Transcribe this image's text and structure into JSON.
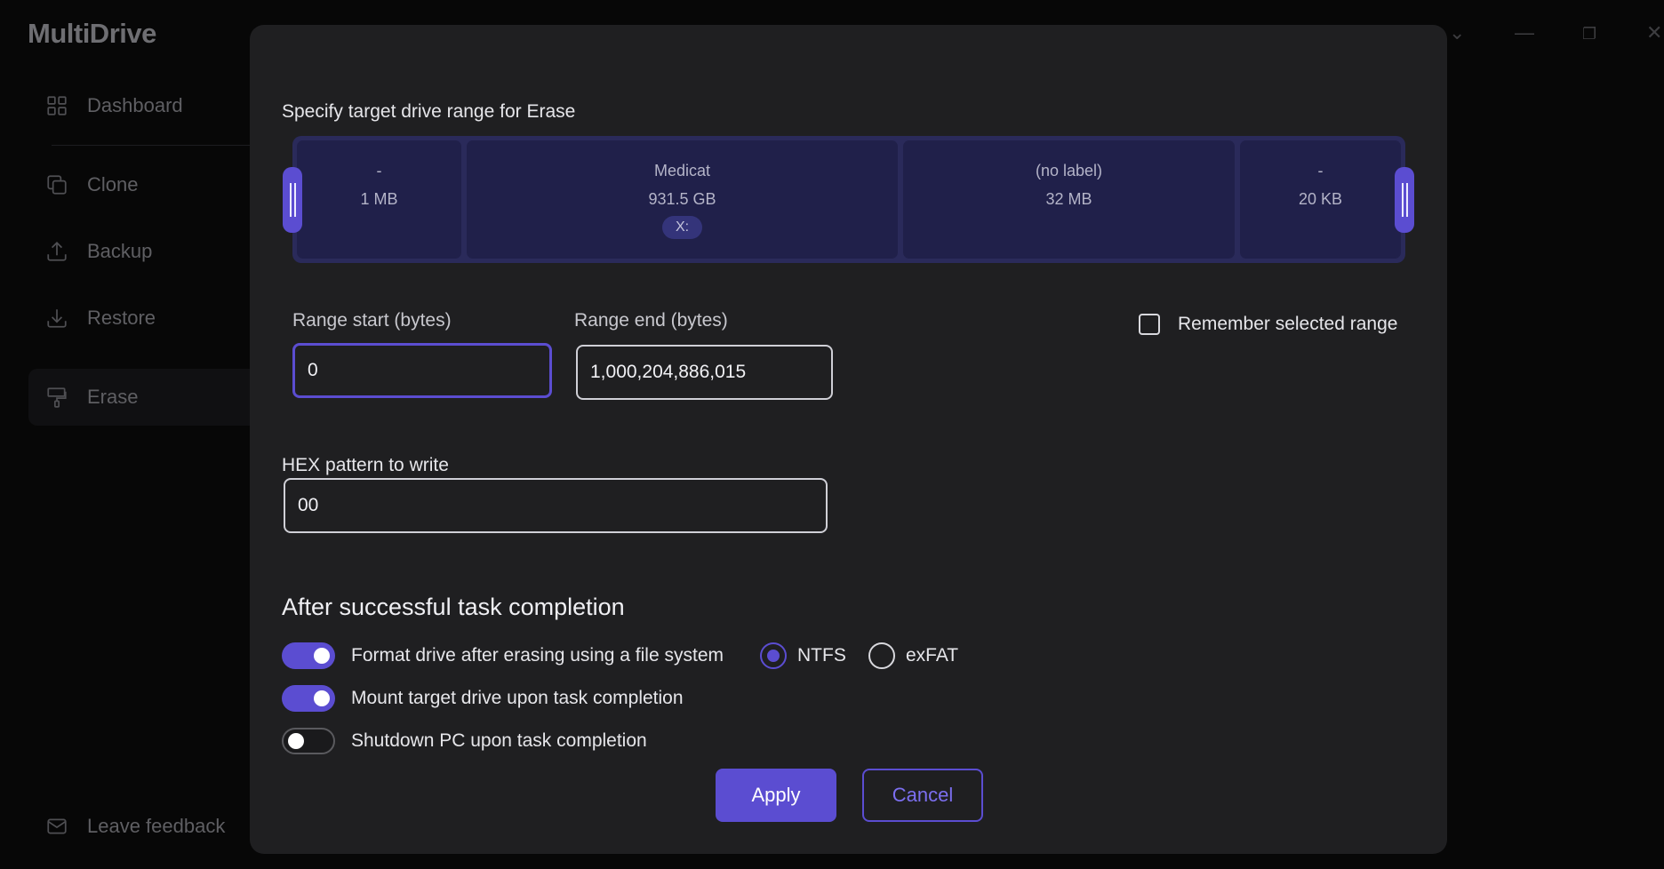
{
  "app": {
    "title": "MultiDrive"
  },
  "sidebar": {
    "items": [
      {
        "label": "Dashboard",
        "icon": "grid-icon"
      },
      {
        "label": "Clone",
        "icon": "copy-icon"
      },
      {
        "label": "Backup",
        "icon": "upload-icon"
      },
      {
        "label": "Restore",
        "icon": "download-icon"
      },
      {
        "label": "Erase",
        "icon": "brush-icon"
      }
    ],
    "active": "Erase",
    "feedback_label": "Leave feedback"
  },
  "modal": {
    "range_title": "Specify target drive range for Erase",
    "partitions": [
      {
        "name": "-",
        "size": "1 MB",
        "letter": ""
      },
      {
        "name": "Medicat",
        "size": "931.5 GB",
        "letter": "X:"
      },
      {
        "name": "(no label)",
        "size": "32 MB",
        "letter": ""
      },
      {
        "name": "-",
        "size": "20 KB",
        "letter": ""
      }
    ],
    "range_start_label": "Range start (bytes)",
    "range_start_value": "0",
    "range_end_label": "Range end (bytes)",
    "range_end_value": "1,000,204,886,015",
    "remember_label": "Remember selected range",
    "remember_checked": false,
    "hex_label": "HEX pattern to write",
    "hex_value": "00",
    "completion_heading": "After successful task completion",
    "options": [
      {
        "label": "Format drive after erasing using a file system",
        "enabled": true
      },
      {
        "label": "Mount target drive upon task completion",
        "enabled": true
      },
      {
        "label": "Shutdown PC upon task completion",
        "enabled": false
      }
    ],
    "file_systems": [
      {
        "label": "NTFS",
        "selected": true
      },
      {
        "label": "exFAT",
        "selected": false
      }
    ],
    "apply_label": "Apply",
    "cancel_label": "Cancel"
  },
  "colors": {
    "accent": "#5b4dd1",
    "background": "#070707",
    "modal": "#1f1f21",
    "partition_segment": "#20204a"
  }
}
